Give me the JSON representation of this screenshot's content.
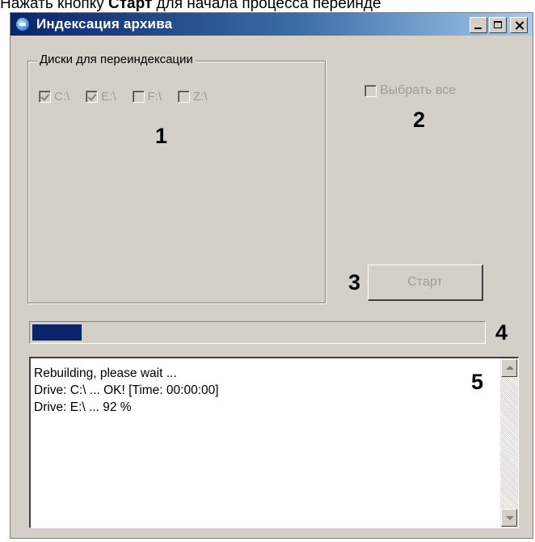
{
  "caption": {
    "prefix": "Нажать кнопку ",
    "bold": "Старт",
    "suffix": " для начала процесса переинде"
  },
  "window": {
    "title": "Индексация архива",
    "title_bar_colors": [
      "#0a246a",
      "#a6caf0"
    ]
  },
  "drives_group": {
    "label": "Диски для переиндексации",
    "drives": [
      {
        "label": "C:\\",
        "checked": true
      },
      {
        "label": "E:\\",
        "checked": true
      },
      {
        "label": "F:\\",
        "checked": false
      },
      {
        "label": "Z:\\",
        "checked": false
      }
    ]
  },
  "select_all": {
    "label": "Выбрать все",
    "checked": false
  },
  "start_button": {
    "label": "Старт"
  },
  "progress": {
    "fraction": 0.11,
    "fill_color": "#0a246a"
  },
  "log": {
    "lines": [
      "Rebuilding, please wait ...",
      "Drive: C:\\ ... OK! [Time: 00:00:00]",
      "Drive: E:\\ ... 92 %"
    ]
  },
  "annotations": {
    "n1": "1",
    "n2": "2",
    "n3": "3",
    "n4": "4",
    "n5": "5"
  }
}
